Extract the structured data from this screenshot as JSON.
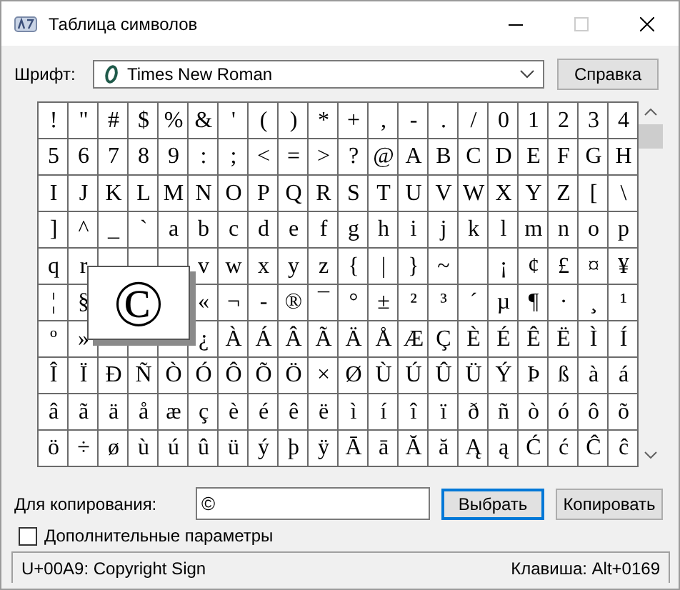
{
  "window": {
    "title": "Таблица символов",
    "maximize_disabled": true
  },
  "font_row": {
    "label": "Шрифт:",
    "value": "Times New Roman",
    "help_button": "Справка"
  },
  "grid": {
    "rows": [
      [
        "!",
        "\"",
        "#",
        "$",
        "%",
        "&",
        "'",
        "(",
        ")",
        "*",
        "+",
        ",",
        "-",
        ".",
        "/",
        "0",
        "1",
        "2",
        "3",
        "4"
      ],
      [
        "5",
        "6",
        "7",
        "8",
        "9",
        ":",
        ";",
        "<",
        "=",
        ">",
        "?",
        "@",
        "A",
        "B",
        "C",
        "D",
        "E",
        "F",
        "G",
        "H"
      ],
      [
        "I",
        "J",
        "K",
        "L",
        "M",
        "N",
        "O",
        "P",
        "Q",
        "R",
        "S",
        "T",
        "U",
        "V",
        "W",
        "X",
        "Y",
        "Z",
        "[",
        "\\"
      ],
      [
        "]",
        "^",
        "_",
        "`",
        "a",
        "b",
        "c",
        "d",
        "e",
        "f",
        "g",
        "h",
        "i",
        "j",
        "k",
        "l",
        "m",
        "n",
        "o",
        "p"
      ],
      [
        "q",
        "r",
        null,
        null,
        null,
        "v",
        "w",
        "x",
        "y",
        "z",
        "{",
        "|",
        "}",
        "~",
        null,
        "¡",
        "¢",
        "£",
        "¤",
        "¥"
      ],
      [
        "¦",
        "§",
        null,
        null,
        null,
        "«",
        "¬",
        "-",
        "®",
        "¯",
        "°",
        "±",
        "²",
        "³",
        "´",
        "µ",
        "¶",
        "·",
        "¸",
        "¹"
      ],
      [
        "º",
        "»",
        null,
        null,
        null,
        "¿",
        "À",
        "Á",
        "Â",
        "Ã",
        "Ä",
        "Å",
        "Æ",
        "Ç",
        "È",
        "É",
        "Ê",
        "Ë",
        "Ì",
        "Í"
      ],
      [
        "Î",
        "Ï",
        "Ð",
        "Ñ",
        "Ò",
        "Ó",
        "Ô",
        "Õ",
        "Ö",
        "×",
        "Ø",
        "Ù",
        "Ú",
        "Û",
        "Ü",
        "Ý",
        "Þ",
        "ß",
        "à",
        "á"
      ],
      [
        "â",
        "ã",
        "ä",
        "å",
        "æ",
        "ç",
        "è",
        "é",
        "ê",
        "ë",
        "ì",
        "í",
        "î",
        "ï",
        "ð",
        "ñ",
        "ò",
        "ó",
        "ô",
        "õ"
      ],
      [
        "ö",
        "÷",
        "ø",
        "ù",
        "ú",
        "û",
        "ü",
        "ý",
        "þ",
        "ÿ",
        "Ā",
        "ā",
        "Ă",
        "ă",
        "Ą",
        "ą",
        "Ć",
        "ć",
        "Ĉ",
        "ĉ"
      ]
    ],
    "magnified": "©"
  },
  "copy": {
    "label": "Для копирования:",
    "value": "©",
    "select_button": "Выбрать",
    "copy_button": "Копировать"
  },
  "advanced": {
    "label": "Дополнительные параметры",
    "checked": false
  },
  "status_bar": {
    "left": "U+00A9: Copyright Sign",
    "right": "Клавиша: Alt+0169"
  }
}
